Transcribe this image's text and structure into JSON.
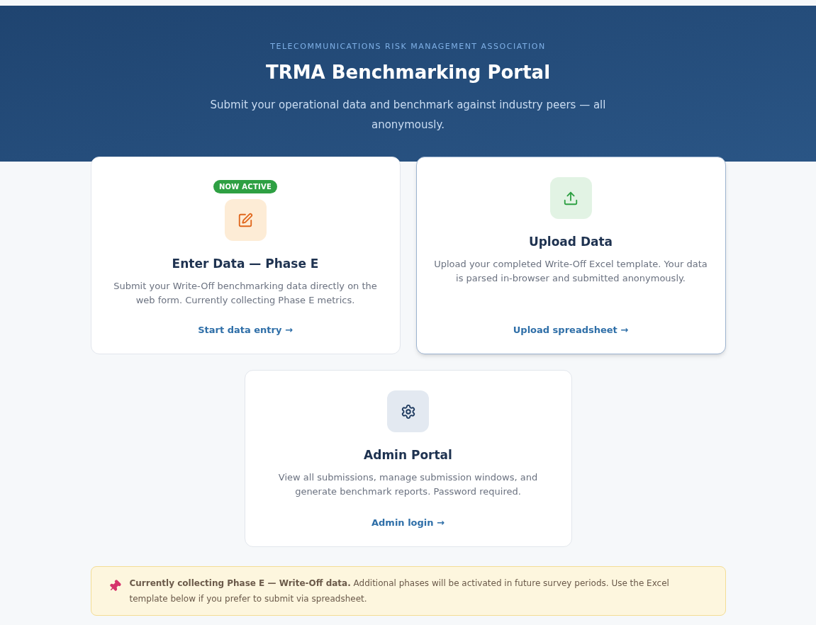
{
  "header": {
    "eyebrow": "TELECOMMUNICATIONS RISK MANAGEMENT ASSOCIATION",
    "title": "TRMA Benchmarking Portal",
    "subtitle": "Submit your operational data and benchmark against industry peers — all anonymously."
  },
  "cards": [
    {
      "kind": "pen",
      "badge": "NOW ACTIVE",
      "title": "Enter Data — Phase E",
      "description": "Submit your Write-Off benchmarking data directly on the web form. Currently collecting Phase E metrics.",
      "link": "Start data entry →",
      "highlighted": false
    },
    {
      "kind": "upload",
      "title": "Upload Data",
      "description": "Upload your completed Write-Off Excel template. Your data is parsed in-browser and submitted anonymously.",
      "link": "Upload spreadsheet →",
      "highlighted": true
    },
    {
      "kind": "gear",
      "title": "Admin Portal",
      "description": "View all submissions, manage submission windows, and generate benchmark reports. Password required.",
      "link": "Admin login →",
      "highlighted": false
    }
  ],
  "notice": {
    "text": "**Currently collecting Phase E — Write-Off data.** Additional phases will be activated in future survey periods. Use the Excel template below if you prefer to submit via spreadsheet."
  }
}
